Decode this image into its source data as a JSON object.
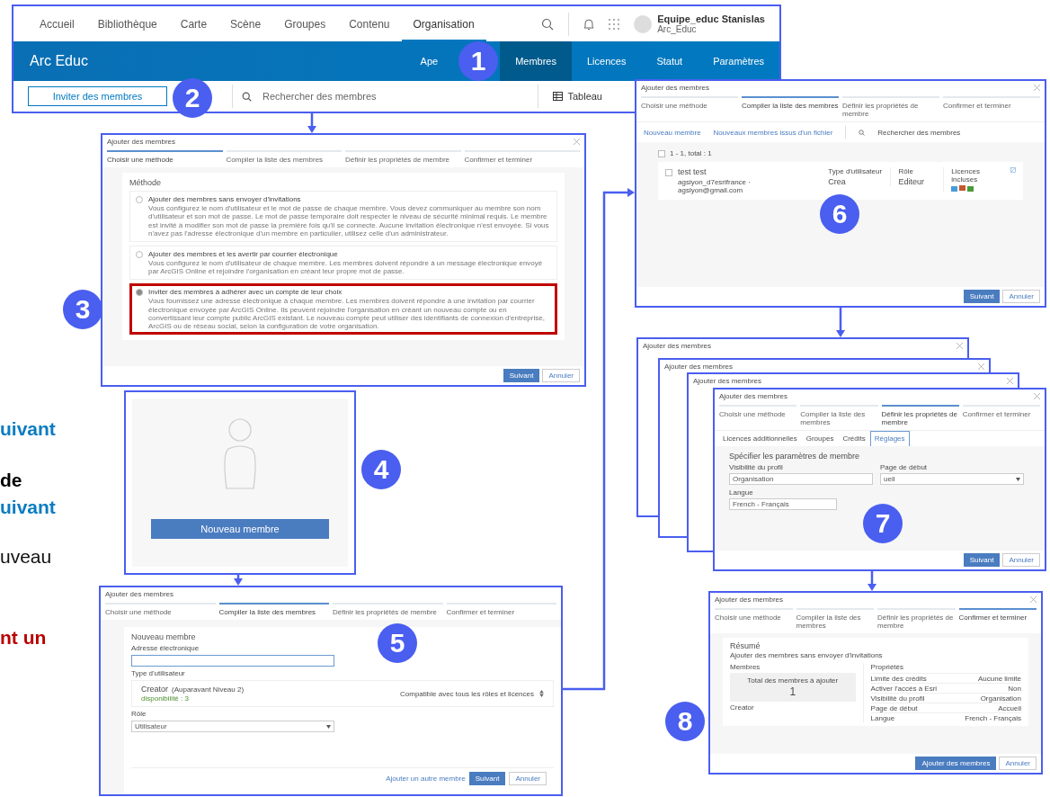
{
  "slide_text": [
    {
      "text": "uivant",
      "kind": "accent"
    },
    {
      "text": "de",
      "kind": "strong"
    },
    {
      "text": "uivant",
      "kind": "accent"
    },
    {
      "text": "uveau",
      "kind": "plain"
    },
    {
      "text": "nt un",
      "kind": "alert"
    }
  ],
  "portal": {
    "nav": [
      {
        "label": "Accueil",
        "selected": false
      },
      {
        "label": "Bibliothèque",
        "selected": false
      },
      {
        "label": "Carte",
        "selected": false
      },
      {
        "label": "Scène",
        "selected": false
      },
      {
        "label": "Groupes",
        "selected": false
      },
      {
        "label": "Contenu",
        "selected": false
      },
      {
        "label": "Organisation",
        "selected": true
      }
    ],
    "user": {
      "name": "Equipe_educ Stanislas",
      "org": "Arc_Educ"
    },
    "org_title": "Arc Educ",
    "org_tabs": [
      {
        "label": "Ape",
        "selected": false
      },
      {
        "label": "Membres",
        "selected": true
      },
      {
        "label": "Licences",
        "selected": false
      },
      {
        "label": "Statut",
        "selected": false
      },
      {
        "label": "Paramètres",
        "selected": false
      }
    ],
    "invite_button": "Inviter des membres",
    "search": {
      "placeholder": "Rechercher des membres"
    },
    "view_button": "Tableau"
  },
  "badges": [
    "1",
    "2",
    "3",
    "4",
    "5",
    "6",
    "7",
    "8"
  ],
  "method_dialog": {
    "title": "Ajouter des membres",
    "steps": [
      {
        "label": "Choisir une méthode",
        "selected": true
      },
      {
        "label": "Compiler la liste des membres",
        "selected": false
      },
      {
        "label": "Définir les propriétés de membre",
        "selected": false
      },
      {
        "label": "Confirmer et terminer",
        "selected": false
      }
    ],
    "heading": "Méthode",
    "options": [
      {
        "title": "Ajouter des membres sans envoyer d'invitations",
        "text": "Vous configurez le nom d'utilisateur et le mot de passe de chaque membre. Vous devez communiquer au membre son nom d'utilisateur et son mot de passe. Le mot de passe temporaire doit respecter le niveau de sécurité minimal requis. Le membre est invité à modifier son mot de passe la première fois qu'il se connecte. Aucune invitation électronique n'est envoyée. Si vous n'avez pas l'adresse électronique d'un membre en particulier, utilisez celle d'un administrateur.",
        "selected": false
      },
      {
        "title": "Ajouter des membres et les avertir par courrier électronique",
        "text": "Vous configurez le nom d'utilisateur de chaque membre. Les membres doivent répondre à un message électronique envoyé par ArcGIS Online et rejoindre l'organisation en créant leur propre mot de passe.",
        "selected": false
      },
      {
        "title": "Inviter des membres à adhérer avec un compte de leur choix",
        "text": "Vous fournissez une adresse électronique à chaque membre. Les membres doivent répondre à une invitation par courrier électronique envoyée par ArcGIS Online. Ils peuvent rejoindre l'organisation en créant un nouveau compte ou en convertissant leur compte public ArcGIS existant. Le nouveau compte peut utiliser des identifiants de connexion d'entreprise, ArcGIS ou de réseau social, selon la configuration de votre organisation.",
        "selected": true
      }
    ],
    "buttons": [
      {
        "label": "Suivant",
        "kind": "primary"
      },
      {
        "label": "Annuler",
        "kind": "secondary"
      }
    ]
  },
  "new_member_card": {
    "button": "Nouveau membre"
  },
  "new_member_dialog": {
    "title": "Ajouter des membres",
    "steps": [
      {
        "label": "Choisir une méthode",
        "selected": false
      },
      {
        "label": "Compiler la liste des membres",
        "selected": true
      },
      {
        "label": "Définir les propriétés de membre",
        "selected": false
      },
      {
        "label": "Confirmer et terminer",
        "selected": false
      }
    ],
    "heading": "Nouveau membre",
    "email_label": "Adresse électronique",
    "type_label": "Type d'utilisateur",
    "type_name": "Creator",
    "type_note": "(Auparavant Niveau 2)",
    "availability": "disponibilité : 3",
    "compat": "Compatible avec tous les rôles et licences",
    "role_label": "Rôle",
    "role_value": "Utilisateur",
    "add_link": "Ajouter un autre membre",
    "buttons": [
      {
        "label": "Suivant",
        "kind": "primary"
      },
      {
        "label": "Annuler",
        "kind": "secondary"
      }
    ]
  },
  "list_dialog": {
    "title": "Ajouter des membres",
    "steps": [
      {
        "label": "Choisir une méthode",
        "selected": false
      },
      {
        "label": "Compiler la liste des membres",
        "selected": true
      },
      {
        "label": "Définir les propriétés de membre",
        "selected": false
      },
      {
        "label": "Confirmer et terminer",
        "selected": false
      }
    ],
    "links": [
      "Nouveau membre",
      "Nouveaux membres issus d'un fichier"
    ],
    "search_placeholder": "Rechercher des membres",
    "count": "1 - 1, total : 1",
    "select_all_checked": false,
    "member": {
      "checked": false,
      "name": "test test",
      "detail": "agslyon_d7esrifrance · agslyon@gmail.com",
      "type_label": "Type d'utilisateur",
      "type_value": "Crea",
      "role_label": "Rôle",
      "role_value": "Editeur",
      "licenses_label": "Licences incluses"
    },
    "buttons": [
      {
        "label": "Suivant",
        "kind": "primary"
      },
      {
        "label": "Annuler",
        "kind": "secondary"
      }
    ]
  },
  "settings_stack": {
    "back_titles": [
      "Ajouter des membres",
      "Ajouter des membres",
      "Ajouter des membres"
    ],
    "front": {
      "title": "Ajouter des membres",
      "steps": [
        {
          "label": "Choisir une méthode",
          "selected": false
        },
        {
          "label": "Compiler la liste des membres",
          "selected": false
        },
        {
          "label": "Définir les propriétés de membre",
          "selected": true
        },
        {
          "label": "Confirmer et terminer",
          "selected": false
        }
      ],
      "tabs": [
        {
          "label": "Licences additionnelles",
          "selected": false
        },
        {
          "label": "Groupes",
          "selected": false
        },
        {
          "label": "Crédits",
          "selected": false
        },
        {
          "label": "Réglages",
          "selected": true
        }
      ],
      "heading": "Spécifier les paramètres de membre",
      "visibility_label": "Visibilité du profil",
      "visibility_value": "Organisation",
      "start_label": "Page de début",
      "start_value": "ueil",
      "language_label": "Langue",
      "language_value": "French - Français",
      "buttons": [
        {
          "label": "Suivant",
          "kind": "primary"
        },
        {
          "label": "Annuler",
          "kind": "secondary"
        }
      ]
    }
  },
  "summary_dialog": {
    "title": "Ajouter des membres",
    "steps": [
      {
        "label": "Choisir une méthode",
        "selected": false
      },
      {
        "label": "Compiler la liste des membres",
        "selected": false
      },
      {
        "label": "Définir les propriétés de membre",
        "selected": false
      },
      {
        "label": "Confirmer et terminer",
        "selected": true
      }
    ],
    "heading": "Résumé",
    "subtitle": "Ajouter des membres sans envoyer d'invitations",
    "members_heading": "Membres",
    "total_label": "Total des membres à ajouter",
    "total": "1",
    "member_type": "Creator",
    "props_heading": "Propriétés",
    "props": [
      {
        "name": "Limite des crédits",
        "value": "Aucune limite"
      },
      {
        "name": "Activer l'accès à Esri",
        "value": "Non"
      },
      {
        "name": "Visibilité du profil",
        "value": "Organisation"
      },
      {
        "name": "Page de début",
        "value": "Accueil"
      },
      {
        "name": "Langue",
        "value": "French - Français"
      }
    ],
    "buttons": [
      {
        "label": "Ajouter des membres",
        "kind": "primary"
      },
      {
        "label": "Annuler",
        "kind": "secondary"
      }
    ]
  }
}
